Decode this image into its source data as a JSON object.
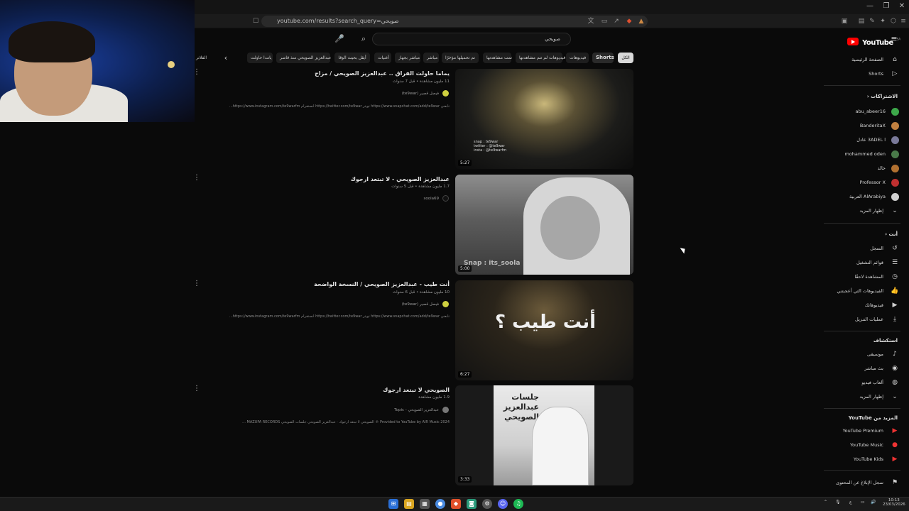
{
  "browser": {
    "url": "youtube.com/results?search_query=صويحي",
    "window_controls": [
      "—",
      "❐",
      "✕"
    ]
  },
  "search": {
    "query": "صويحي",
    "clear_icon": "close-icon",
    "search_icon": "search-icon",
    "mic_icon": "mic-icon"
  },
  "filters": {
    "chips": [
      "الكل",
      "Shorts",
      "فيديوهات",
      "فيديوهات لم تتم مشاهدتها",
      "تمت مشاهدتها",
      "تم تحميلها مؤخرًا",
      "مباشر",
      "مباشر بجهاز",
      "أغنيات",
      "أيقل بحيث الوقا",
      "عبدالعزيز الصويحي منذ قاصر",
      "يامدا حاولت"
    ],
    "filters_label": "الفلاتر"
  },
  "results": [
    {
      "title": "يماما حاولت الفراق .. عبدالعزيز الصويحي / مزاج",
      "meta": "11 مليون مشاهدة • قبل 7 سنوات",
      "channel": "فيصل قصير (te9war)",
      "description": "تابعني https://www.snapchat.com/add/te9war تويتر https://twitter.com/te9war انستقرام https://www.instagram.com/te9warfm...",
      "duration": "5:27",
      "thumb_caption": "snap : te9war\ntwitter : @te9war\ninsta : @te9warfm"
    },
    {
      "title": "عبدالعزيز الصويحي - لا تبتعد ارجوك",
      "meta": "1.7 مليون مشاهدة • قبل 5 سنوات",
      "channel": "soola69",
      "description": "",
      "duration": "5:00",
      "thumb_caption": "Snap : its_soola"
    },
    {
      "title": "أنت طيب - عبدالعزيز الصويحي / النسخة الواضحة",
      "meta": "10 مليون مشاهدة • قبل 6 سنوات",
      "channel": "فيصل قصير (te9war)",
      "description": "تابعني https://www.snapchat.com/add/te9war تويتر https://twitter.com/te9war انستقرام https://www.instagram.com/te9warfm...",
      "duration": "6:27",
      "thumb_caption": "أنت طيب ؟"
    },
    {
      "title": "الصويحي لا تبتعد ارجوك",
      "meta": "1.9 مليون مشاهدة",
      "channel": "عبدالعزيز الصويحي - Topic",
      "description": "Provided to YouTube by AIR Music 2024 ℗ الصويحي لا تبتعد ارجوك · عبدالعزيز الصويحي جلسات الصويحي MAZUFA RECORDS ...",
      "duration": "3:33",
      "thumb_caption": "جلسات عبدالعزيز الصويحي"
    }
  ],
  "sidebar": {
    "logo": "YouTube",
    "logo_sup": "SA",
    "main": [
      {
        "label": "الصفحة الرئيسية",
        "icon": "home-icon"
      },
      {
        "label": "Shorts",
        "icon": "shorts-icon"
      }
    ],
    "subscriptions_title": "الاشتراكات",
    "subscriptions": [
      {
        "label": "abu_abeer16",
        "color": "#3da84a"
      },
      {
        "label": "BanderitaX",
        "color": "#c08040"
      },
      {
        "label": "3ADEL l عادل",
        "color": "#7a7a9a"
      },
      {
        "label": "mohammed oden",
        "color": "#4a7a4a"
      },
      {
        "label": "خالد",
        "color": "#b07030"
      },
      {
        "label": "Professor X",
        "color": "#c03030"
      },
      {
        "label": "AlArabiya العربية",
        "color": "#d0d0d0"
      }
    ],
    "show_more": "إظهار المزيد",
    "you_title": "أنت",
    "you": [
      {
        "label": "السجل",
        "icon": "history-icon"
      },
      {
        "label": "قوائم التشغيل",
        "icon": "playlist-icon"
      },
      {
        "label": "المشاهدة لاحقًا",
        "icon": "clock-icon"
      },
      {
        "label": "الفيديوهات التي أعجبتني",
        "icon": "thumbs-up-icon"
      },
      {
        "label": "فيديوهاتك",
        "icon": "video-icon"
      },
      {
        "label": "عمليات التنزيل",
        "icon": "download-icon"
      }
    ],
    "explore_title": "استكشاف",
    "explore": [
      {
        "label": "موسيقى",
        "icon": "music-icon"
      },
      {
        "label": "بث مباشر",
        "icon": "live-icon"
      },
      {
        "label": "ألعاب فيديو",
        "icon": "gamepad-icon"
      },
      {
        "label": "إظهار المزيد",
        "icon": "chevron-down-icon"
      }
    ],
    "more_title": "المزيد من YouTube",
    "more": [
      {
        "label": "YouTube Premium",
        "color": "#e33"
      },
      {
        "label": "YouTube Music",
        "color": "#e33"
      },
      {
        "label": "YouTube Kids",
        "color": "#e33"
      }
    ],
    "report": "سجل الإبلاغ عن المحتوى"
  },
  "taskbar": {
    "time": "10:13",
    "date": "23/03/2026",
    "lang": "ع"
  }
}
